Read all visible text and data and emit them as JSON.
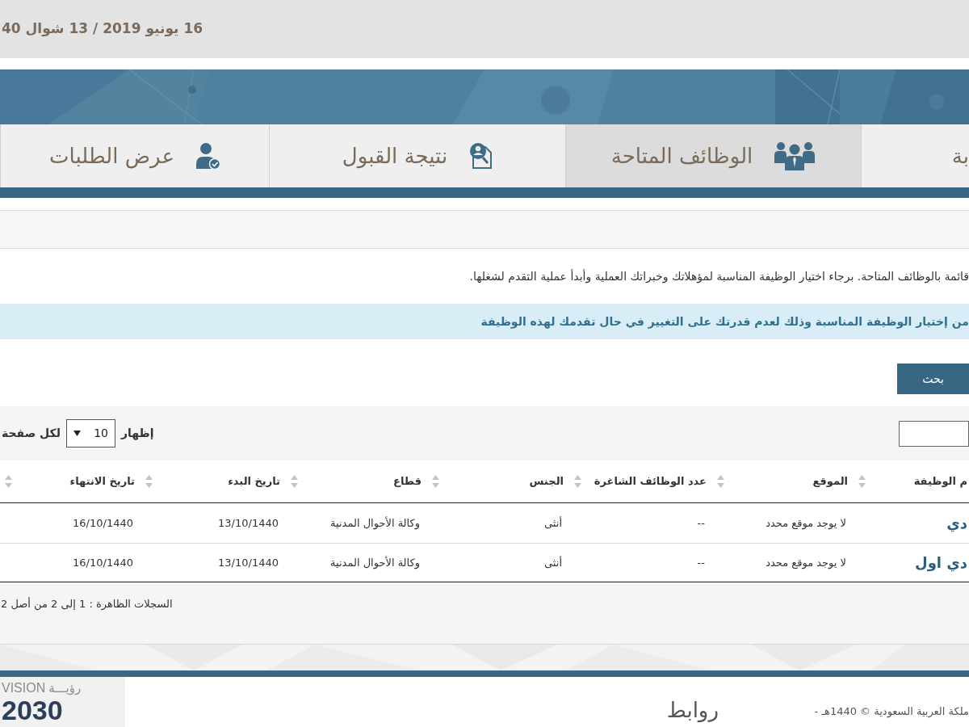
{
  "top_bar": {
    "date": "16 يونيو 2019 / 13 شوال 40"
  },
  "tabs": [
    {
      "label": "بة",
      "selected": false
    },
    {
      "label": "الوظائف المتاحة",
      "selected": true
    },
    {
      "label": "نتيجة القبول",
      "selected": false
    },
    {
      "label": "عرض الطلبات",
      "selected": false
    }
  ],
  "intro": "قائمة بالوظائف المتاحة. برجاء اختيار الوظيفة المناسبة لمؤهلاتك وخبراتك العملية وأبدأ عملية التقدم لشغلها.",
  "alert": "من إختيار الوظيفة المناسبة وذلك لعدم قدرتك على التغيير في حال تقدمك لهذه الوظيفة",
  "search_button": "بحث",
  "page_length": {
    "label": "إظهار",
    "value": "10",
    "suffix": "لكل صفحة"
  },
  "table": {
    "columns": [
      {
        "label": "م الوظيفة",
        "sortable": false
      },
      {
        "label": "الموقع",
        "sortable": true
      },
      {
        "label": "عدد الوظائف الشاغرة",
        "sortable": true
      },
      {
        "label": "الجنس",
        "sortable": true
      },
      {
        "label": "قطاع",
        "sortable": true
      },
      {
        "label": "تاريخ البدء",
        "sortable": true
      },
      {
        "label": "تاريخ الانتهاء",
        "sortable": true
      },
      {
        "sortable": true
      }
    ],
    "rows": [
      {
        "cells": [
          "دي",
          "لا يوجد موقع محدد",
          "--",
          "أنثى",
          "وكالة الأحوال المدنية",
          "13/10/1440",
          "16/10/1440"
        ]
      },
      {
        "cells": [
          "دي اول",
          "لا يوجد موقع محدد",
          "--",
          "أنثى",
          "وكالة الأحوال المدنية",
          "13/10/1440",
          "16/10/1440"
        ]
      }
    ]
  },
  "table_info": "السجلات الظاهرة : 1 إلى 2 من أصل 2",
  "footer": {
    "copyright": "ملكة العربية السعودية © 1440هـ -",
    "links_heading": "روابط",
    "logo": {
      "latin": "VISION",
      "arabic": "رؤيـــة",
      "year": "2030"
    }
  }
}
